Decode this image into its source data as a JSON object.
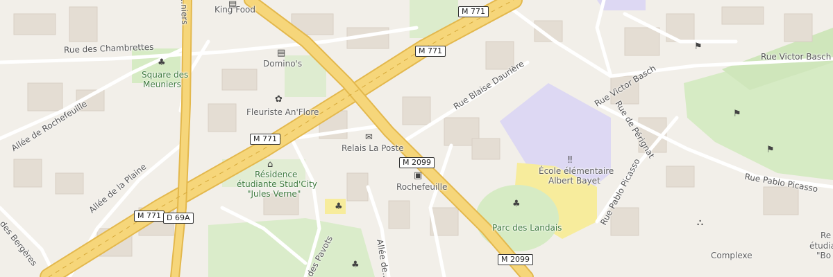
{
  "streets": {
    "chambrettes": "Rue des Chambrettes",
    "rochefeuille": "Allée de Rochefeuille",
    "plaine": "Allée de la Plaine",
    "bergeres": "...des Bergères",
    "meuniers_top": "...niers",
    "blaise": "Rue Blaise Daurière",
    "victor_basch_top": "Rue Victor Basch",
    "victor_basch_diag": "Rue Victor Basch",
    "perignat": "Rue de Pérignat",
    "picasso_h": "Rue Pablo Picasso",
    "picasso_diag": "Rue Pablo Picasso",
    "pavots": "...des Pavots",
    "allee_de": "Allée de..."
  },
  "shields": {
    "m771_top": "M 771",
    "m771_mid": "M 771",
    "m771_left": "M 771",
    "m771_bottom": "M 771",
    "d69a": "D 69A",
    "m2099_mid": "M 2099",
    "m2099_bottom": "M 2099"
  },
  "pois": {
    "king_food": "King Food",
    "dominos": "Domino's",
    "fleuriste": "Fleuriste An'Flore",
    "relais": "Relais La Poste",
    "rochefeuille_stop": "Rochefeuille",
    "square_line1": "Square des",
    "square_line2": "Meuniers",
    "residence_line1": "Résidence",
    "residence_line2": "étudiante Stud'City",
    "residence_line3": "\"Jules Verne\"",
    "ecole_line1": "École élémentaire",
    "ecole_line2": "Albert Bayet",
    "parc": "Parc des Landais",
    "complexe": "Complexe",
    "right_edge_1": "Re",
    "right_edge_2": "étudia",
    "right_edge_3": "\"Bo"
  },
  "icons": {
    "restaurant": "restaurant-icon",
    "shop": "florist-icon",
    "post": "post-office-icon",
    "bus": "bus-stop-icon",
    "park": "park-tree-icon",
    "school": "school-icon",
    "lodging": "student-residence-icon",
    "sport": "sport-icon"
  },
  "colors": {
    "background": "#f2efe9",
    "major_road": "#f6d67a",
    "major_road_casing": "#e3b84d",
    "minor_road": "#ffffff",
    "park": "#d6ebc4",
    "school": "#ddd8f3",
    "sports_field": "#f7ec9c"
  }
}
